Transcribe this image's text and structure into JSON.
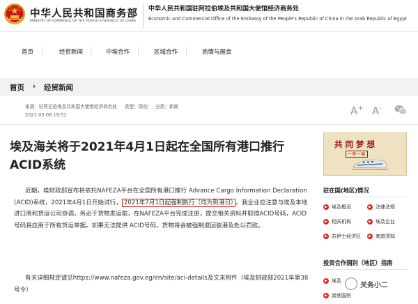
{
  "header": {
    "ministry_cn": "中华人民共和国商务部",
    "ministry_en": "MINISTRY OF COMMERCE OF THE PEOPLE'S REPUBLIC OF CHINA",
    "office_cn": "中华人民共和国驻阿拉伯埃及共和国大使馆经济商务处",
    "office_en": "Economic and Commercial Office of the Embassy of the People's Republic of China in the Arab Republic of Egypt"
  },
  "nav": {
    "items": [
      "首页",
      "经贸新闻",
      "中埃合作",
      "区域合作",
      "商情与展会"
    ]
  },
  "breadcrumb": {
    "home": "首页",
    "separator": "›",
    "current": "经贸新闻"
  },
  "meta": {
    "source": "来源：驻阿拉伯埃及共和国大使馆经济商务处",
    "type": "类型：原创",
    "category": "分类：新闻",
    "date": "2021-03-08 19:51"
  },
  "tools": {
    "font_large": "A",
    "font_small": "A",
    "font_plus": "+",
    "font_minus": "-"
  },
  "article": {
    "title": "埃及海关将于2021年4月1日起在全国所有港口推行ACID系统",
    "p1_a": "近期，埃财政部宣布将依托NAFEZA平台在全国所有港口推行 Advance Cargo Information Declaration (ACID)系统，2021年4月1日开始试行，",
    "p1_highlight": "2021年7月1日起强制执行（均为到港日）",
    "p1_b": "。我企业应注意与埃及本地进口商和货运公司协调，务必于货物发运前，在NAFEZA平台完成注册，提交相关资料并取得ACID号码，ACID号码将应用于所有货运单据。如果无法提供 ACID号码，货物将会被强制退回装港及处以罚款。",
    "p2": "有关详细规定请见https://www.nafeza.gov.eg/en/site/aci-details及文末附件（埃及财政部2021年第38号令）"
  },
  "sidebar": {
    "promo_title": "共同梦想",
    "promo_sub": "一带一路",
    "section1_title": "驻在国(地区)情况",
    "section1_items": [
      "埃及概况",
      "法律法规",
      "相关机构",
      "埃及企业",
      "苏伊士经济区",
      "商旅须知"
    ],
    "section2_title": "投资合作国别（地区）指南",
    "section2_items": [
      "埃及",
      "其他国别"
    ]
  },
  "watermark": {
    "text": "关务小二"
  },
  "colors": {
    "highlight_border": "#e02020",
    "bullet": "#e02424",
    "promo_bg": "#efe2c2",
    "promo_text": "#9a1a1a"
  }
}
